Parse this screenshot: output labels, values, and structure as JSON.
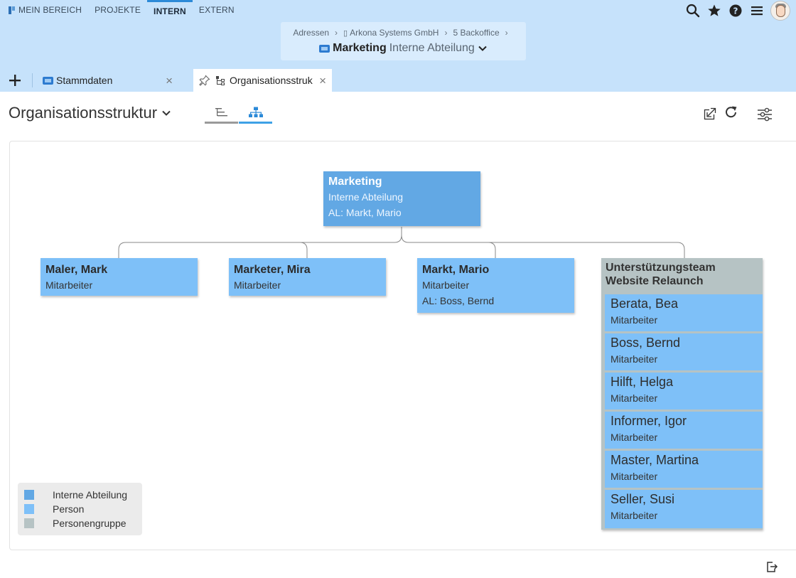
{
  "nav": {
    "items": [
      "MEIN BEREICH",
      "PROJEKTE",
      "INTERN",
      "EXTERN"
    ],
    "active": "INTERN"
  },
  "icons": [
    "search-icon",
    "star-icon",
    "help-icon",
    "menu-icon",
    "avatar"
  ],
  "breadcrumb": {
    "items": [
      "Adressen",
      "Arkona Systems GmbH",
      "5 Backoffice"
    ],
    "title": "Marketing",
    "subtitle": "Interne Abteilung"
  },
  "tabs": [
    {
      "label": "Stammdaten"
    },
    {
      "label": "Organisationsstruk"
    }
  ],
  "page": {
    "title": "Organisationsstruktur"
  },
  "colors": {
    "interne_abteilung": "#62a8e4",
    "person": "#7ec0f8",
    "personengruppe": "#b6c3c4",
    "accent": "#3ea1e6"
  },
  "org": {
    "root": {
      "name": "Marketing",
      "type": "Interne Abteilung",
      "lead": "AL: Markt, Mario"
    },
    "children": [
      {
        "name": "Maler, Mark",
        "role": "Mitarbeiter"
      },
      {
        "name": "Marketer, Mira",
        "role": "Mitarbeiter"
      },
      {
        "name": "Markt, Mario",
        "role": "Mitarbeiter",
        "lead": "AL: Boss, Bernd"
      }
    ],
    "group": {
      "title_line1": "Unterstützungsteam",
      "title_line2": "Website Relaunch",
      "members": [
        {
          "name": "Berata, Bea",
          "role": "Mitarbeiter"
        },
        {
          "name": "Boss, Bernd",
          "role": "Mitarbeiter"
        },
        {
          "name": "Hilft, Helga",
          "role": "Mitarbeiter"
        },
        {
          "name": "Informer, Igor",
          "role": "Mitarbeiter"
        },
        {
          "name": "Master, Martina",
          "role": "Mitarbeiter"
        },
        {
          "name": "Seller, Susi",
          "role": "Mitarbeiter"
        }
      ]
    }
  },
  "legend": [
    {
      "label": "Interne Abteilung",
      "color": "#62a8e4"
    },
    {
      "label": "Person",
      "color": "#7ec0f8"
    },
    {
      "label": "Personengruppe",
      "color": "#b6c3c4"
    }
  ]
}
